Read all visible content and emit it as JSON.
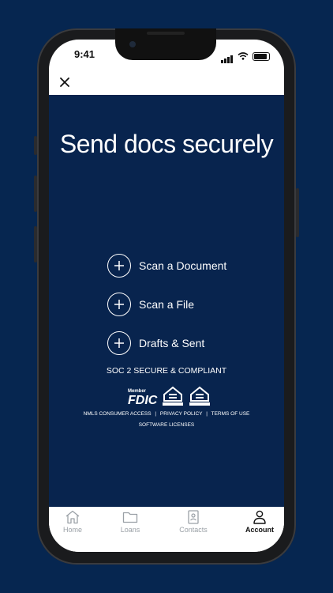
{
  "status": {
    "time": "9:41"
  },
  "content": {
    "title": "Send docs securely",
    "actions": [
      {
        "label": "Scan a Document"
      },
      {
        "label": "Scan a File"
      },
      {
        "label": "Drafts & Sent"
      }
    ],
    "compliance": "SOC 2 SECURE & COMPLIANT",
    "badges": {
      "fdic_member": "Member",
      "fdic": "FDIC",
      "equal_housing_lender": "EQUAL HOUSING LENDER",
      "equal_housing_opportunity": "EQUAL HOUSING OPPORTUNITY"
    },
    "links": [
      "NMLS CONSUMER ACCESS",
      "PRIVACY POLICY",
      "TERMS OF USE"
    ],
    "software_licenses": "SOFTWARE LICENSES"
  },
  "tabs": [
    {
      "label": "Home",
      "icon": "home-icon",
      "active": false
    },
    {
      "label": "Loans",
      "icon": "folder-icon",
      "active": false
    },
    {
      "label": "Contacts",
      "icon": "contact-card-icon",
      "active": false
    },
    {
      "label": "Account",
      "icon": "person-icon",
      "active": true
    }
  ],
  "colors": {
    "background": "#062650",
    "content": "#08244e",
    "active_tab": "#111111",
    "inactive_tab": "#9aa0a6"
  }
}
